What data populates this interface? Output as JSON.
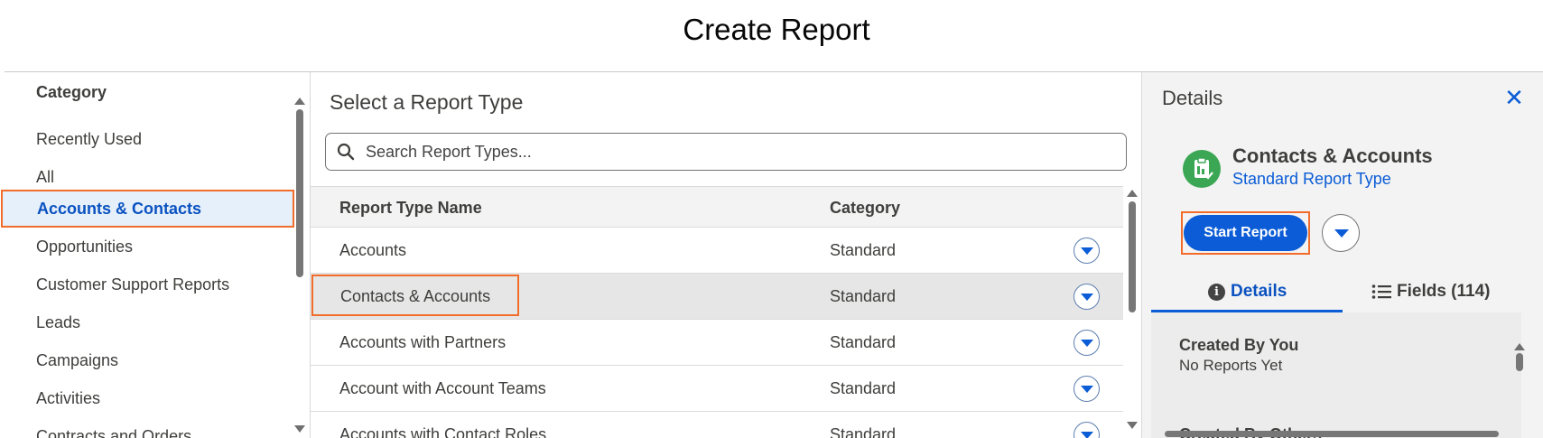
{
  "page": {
    "title": "Create Report"
  },
  "category_panel": {
    "heading": "Category",
    "items": [
      {
        "label": "Recently Used",
        "selected": false
      },
      {
        "label": "All",
        "selected": false
      },
      {
        "label": "Accounts & Contacts",
        "selected": true
      },
      {
        "label": "Opportunities",
        "selected": false
      },
      {
        "label": "Customer Support Reports",
        "selected": false
      },
      {
        "label": "Leads",
        "selected": false
      },
      {
        "label": "Campaigns",
        "selected": false
      },
      {
        "label": "Activities",
        "selected": false
      },
      {
        "label": "Contracts and Orders",
        "selected": false
      }
    ]
  },
  "report_types": {
    "heading": "Select a Report Type",
    "search": {
      "placeholder": "Search Report Types...",
      "value": ""
    },
    "columns": {
      "name": "Report Type Name",
      "category": "Category"
    },
    "rows": [
      {
        "name": "Accounts",
        "category": "Standard",
        "selected": false
      },
      {
        "name": "Contacts & Accounts",
        "category": "Standard",
        "selected": true
      },
      {
        "name": "Accounts with Partners",
        "category": "Standard",
        "selected": false
      },
      {
        "name": "Account with Account Teams",
        "category": "Standard",
        "selected": false
      },
      {
        "name": "Accounts with Contact Roles",
        "category": "Standard",
        "selected": false
      }
    ]
  },
  "details_panel": {
    "heading": "Details",
    "report_type_title": "Contacts & Accounts",
    "report_type_subtitle": "Standard Report Type",
    "start_button": "Start Report",
    "tabs": {
      "details": "Details",
      "fields": "Fields (114)"
    },
    "created_by_you_label": "Created By You",
    "created_by_you_value": "No Reports Yet",
    "created_by_others_label": "Created By Others"
  },
  "colors": {
    "brand_blue": "#0b5cd6",
    "highlight_outline": "#f26c2b",
    "report_icon_green": "#3ba755"
  }
}
